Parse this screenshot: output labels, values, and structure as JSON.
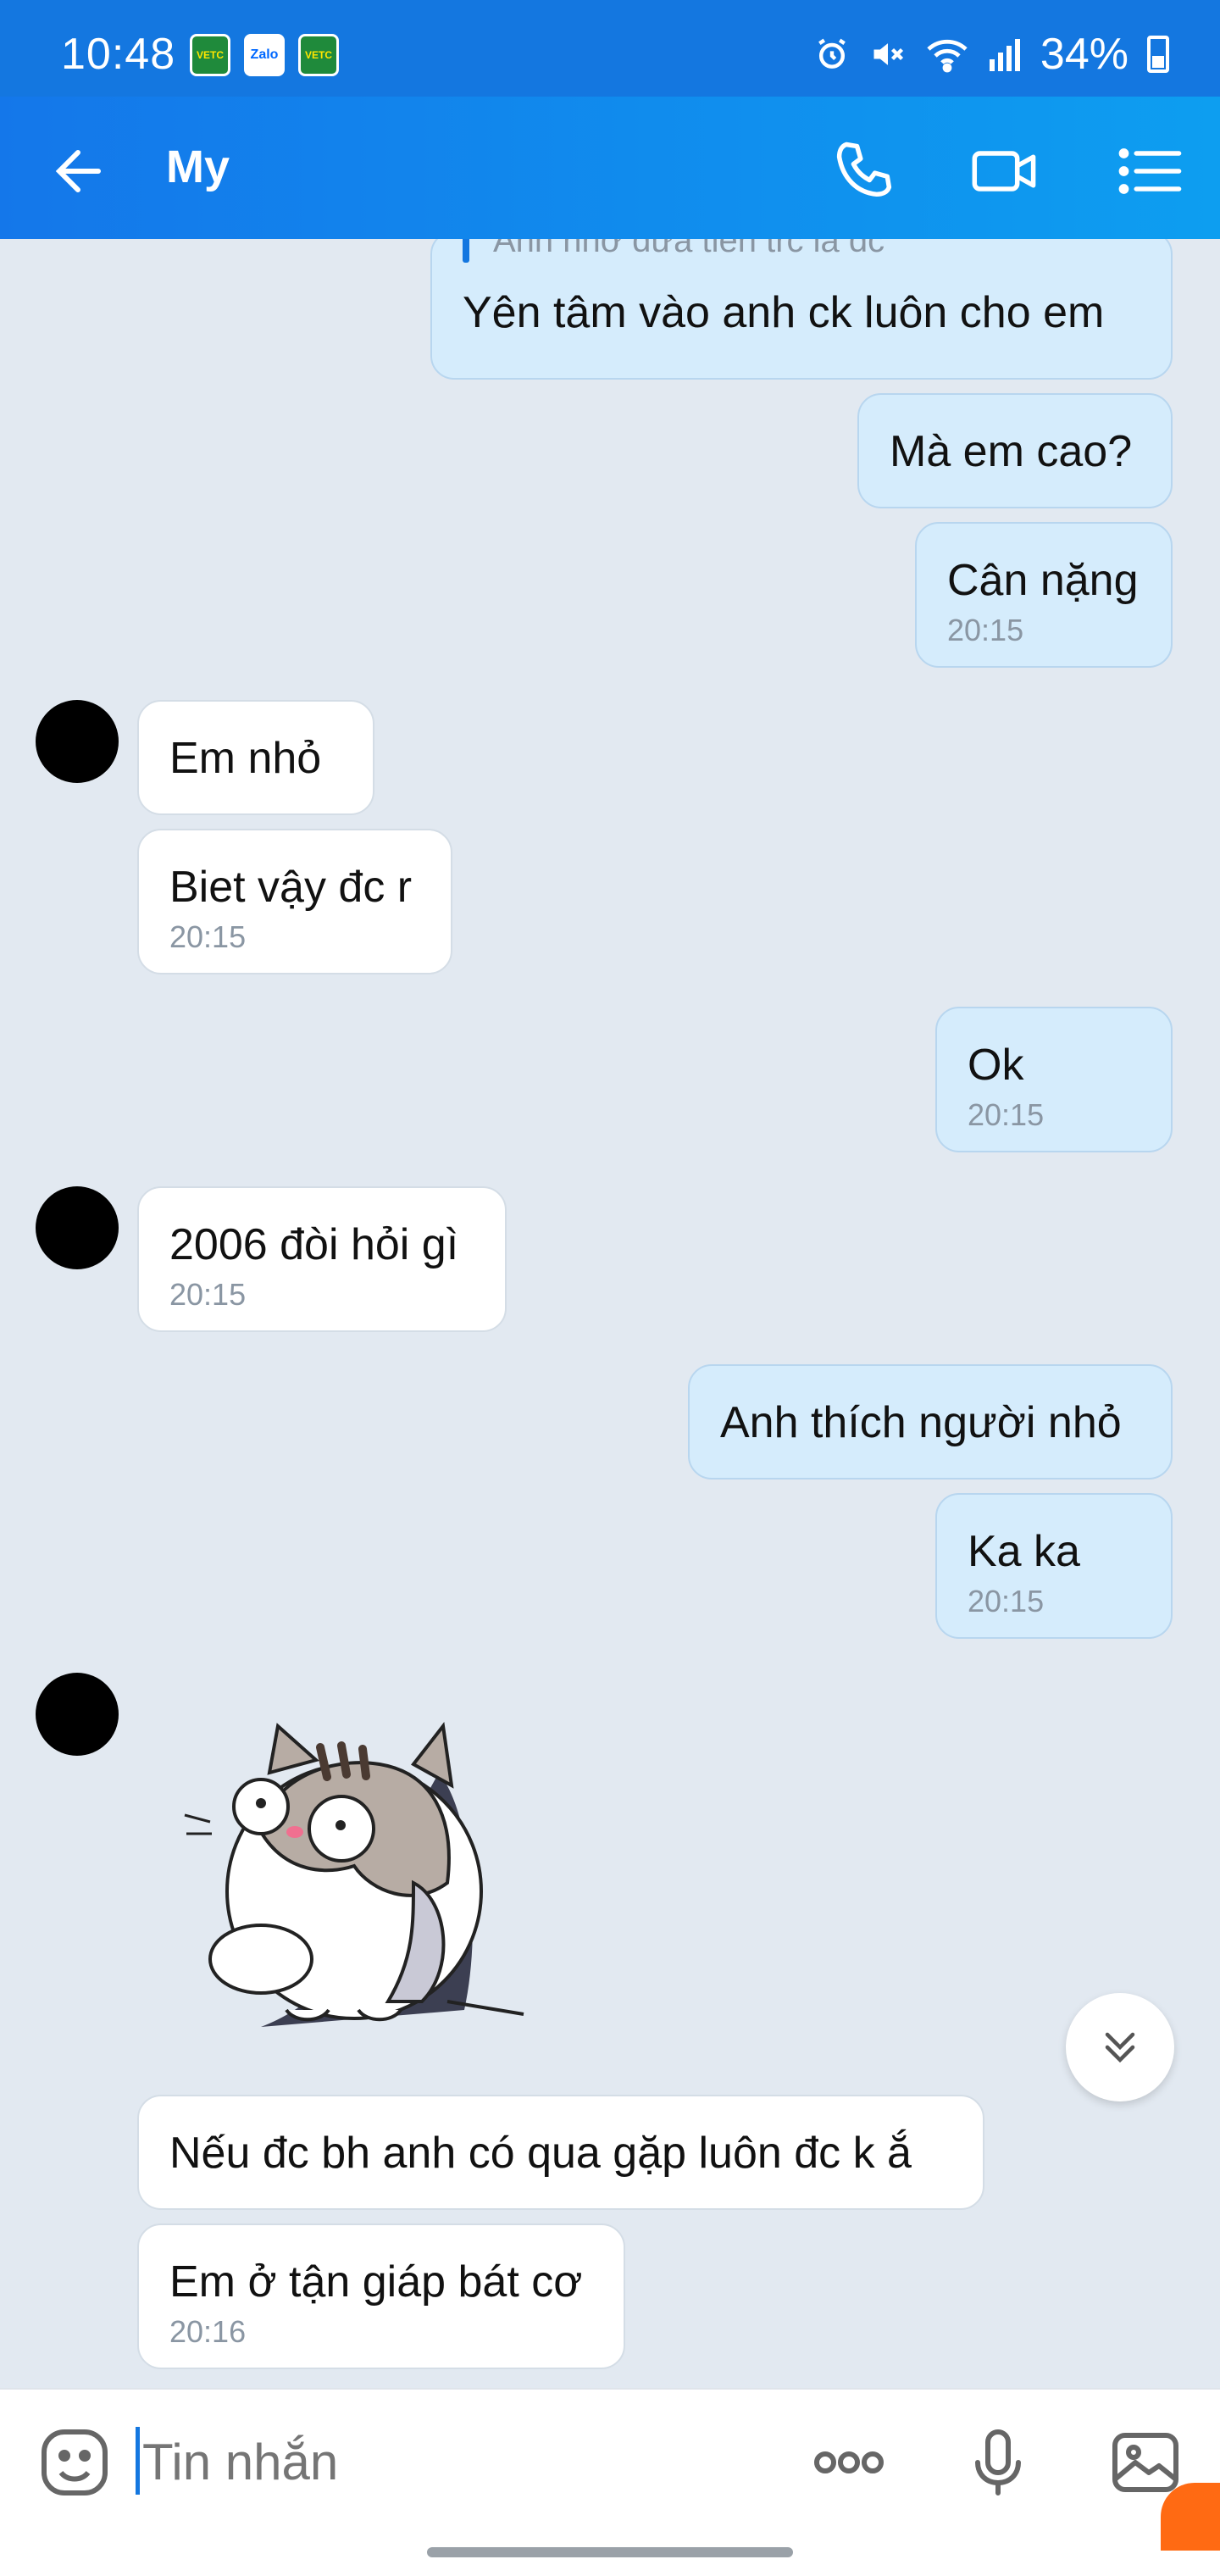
{
  "status_bar": {
    "time": "10:48",
    "apps": [
      "VETC",
      "Zalo",
      "VETC"
    ],
    "battery": "34%"
  },
  "header": {
    "title": "My",
    "icons": [
      "back-arrow-icon",
      "phone-icon",
      "video-call-icon",
      "menu-list-icon"
    ]
  },
  "messages": [
    {
      "side": "mine",
      "quote": "Anh nhớ dưa tiền trc là dc",
      "text": "Yên tâm vào anh ck luôn cho em",
      "time": ""
    },
    {
      "side": "mine",
      "text": "Mà em cao?",
      "time": ""
    },
    {
      "side": "mine",
      "text": "Cân nặng",
      "time": "20:15"
    },
    {
      "side": "theirs",
      "text": "Em nhỏ",
      "time": ""
    },
    {
      "side": "theirs",
      "text": "Biet vậy đc r",
      "time": "20:15"
    },
    {
      "side": "mine",
      "text": "Ok",
      "time": "20:15"
    },
    {
      "side": "theirs",
      "text": "2006 đòi hỏi gì",
      "time": "20:15"
    },
    {
      "side": "mine",
      "text": "Anh thích người nhỏ",
      "time": ""
    },
    {
      "side": "mine",
      "text": "Ka ka",
      "time": "20:15"
    },
    {
      "side": "theirs",
      "type": "sticker",
      "sticker": "cat-sticker"
    },
    {
      "side": "theirs",
      "text": "Nếu đc bh anh có qua gặp luôn đc k ắ",
      "time": ""
    },
    {
      "side": "theirs",
      "text": "Em ở tận giáp bát cơ",
      "time": "20:16"
    }
  ],
  "input": {
    "placeholder": "Tin nhắn",
    "icons": [
      "emoji-icon",
      "more-options-icon",
      "microphone-icon",
      "image-icon"
    ]
  },
  "colors": {
    "header": "#1477e0",
    "my_bubble": "#d5ecfc",
    "their_bubble": "#ffffff",
    "background": "#e2e9f1"
  }
}
